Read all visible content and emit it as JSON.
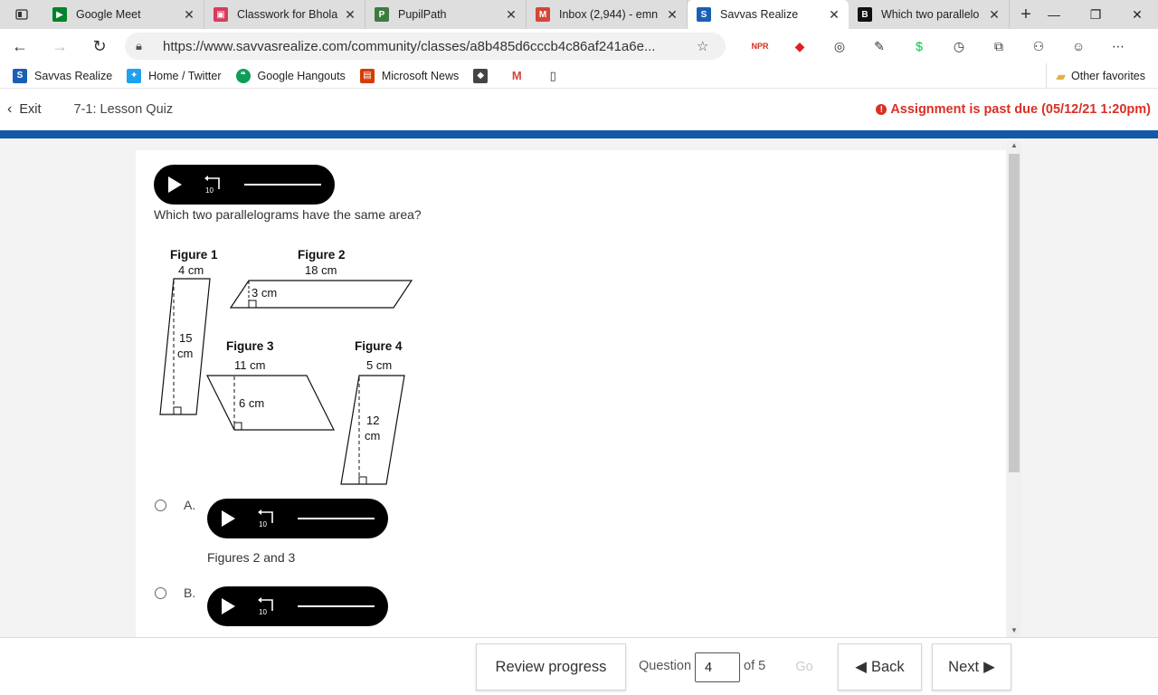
{
  "browser": {
    "tabs": [
      {
        "title": "Google Meet",
        "color": "#00832d",
        "glyph": "▶",
        "active": false
      },
      {
        "title": "Classwork for Bhola",
        "color": "#d93b5d",
        "glyph": "▣",
        "active": false
      },
      {
        "title": "PupilPath",
        "color": "#3f7a3f",
        "glyph": "P",
        "active": false
      },
      {
        "title": "Inbox (2,944) - emn",
        "color": "#d44638",
        "glyph": "M",
        "active": false
      },
      {
        "title": "Savvas Realize",
        "color": "#1a5fb4",
        "glyph": "S",
        "active": true
      },
      {
        "title": "Which two parallelo",
        "color": "#111111",
        "glyph": "B",
        "active": false
      }
    ],
    "url": "https://www.savvasrealize.com/community/classes/a8b485d6cccb4c86af241a6e...",
    "favorites": [
      {
        "label": "Savvas Realize",
        "color": "#1a5fb4",
        "glyph": "S"
      },
      {
        "label": "Home / Twitter",
        "color": "#1da1f2",
        "glyph": "✦"
      },
      {
        "label": "Google Hangouts",
        "color": "#0f9d58",
        "glyph": "❝"
      },
      {
        "label": "Microsoft News",
        "color": "#d83b01",
        "glyph": "▤"
      }
    ],
    "other_favorites": "Other favorites"
  },
  "header": {
    "exit_label": "Exit",
    "quiz_title": "7-1: Lesson Quiz",
    "past_due": "Assignment is past due (05/12/21 1:20pm)"
  },
  "question": {
    "text": "Which two parallelograms have the same area?",
    "replay_label": "10",
    "figures": {
      "f1": {
        "title": "Figure 1",
        "base": "4 cm",
        "height_line1": "15",
        "height_line2": "cm"
      },
      "f2": {
        "title": "Figure 2",
        "base": "18 cm",
        "height": "3 cm"
      },
      "f3": {
        "title": "Figure 3",
        "base": "11 cm",
        "height": "6 cm"
      },
      "f4": {
        "title": "Figure 4",
        "base": "5 cm",
        "height_line1": "12",
        "height_line2": "cm"
      }
    },
    "options": [
      {
        "letter": "A.",
        "text": "Figures 2 and 3"
      },
      {
        "letter": "B.",
        "text": ""
      }
    ]
  },
  "footer": {
    "review_label": "Review progress",
    "question_label": "Question",
    "current_question": "4",
    "of_label": "of 5",
    "go_label": "Go",
    "back_label": "Back",
    "next_label": "Next"
  }
}
